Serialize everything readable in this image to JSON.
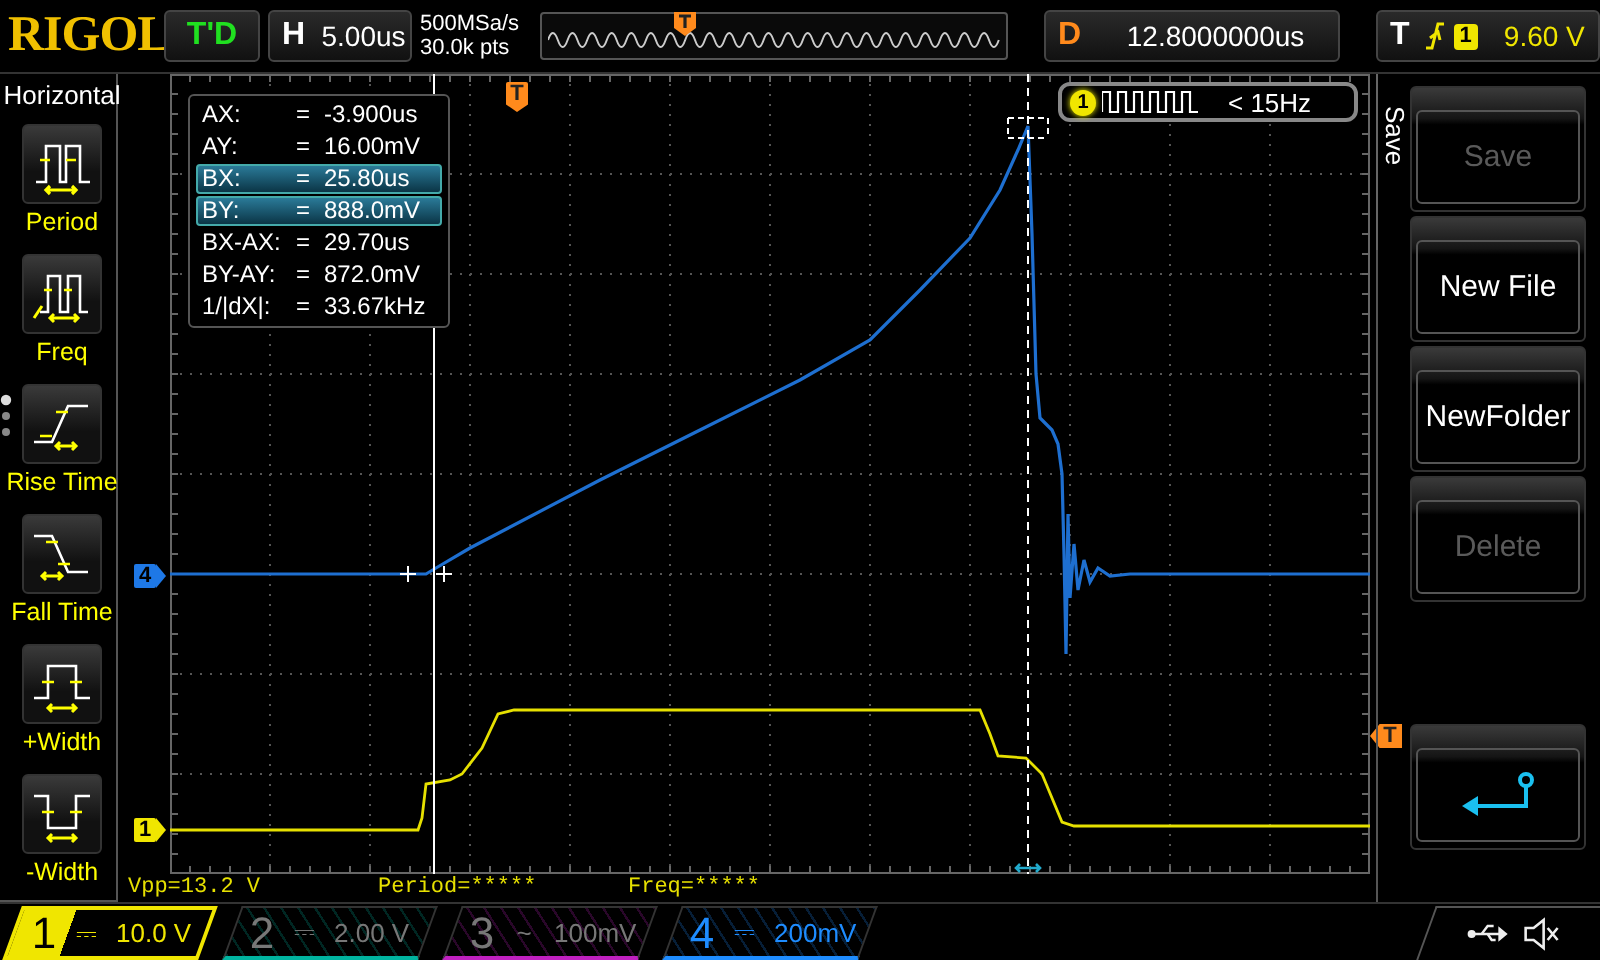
{
  "top_bar": {
    "logo": "RIGOL",
    "run_state": "T'D",
    "timebase": {
      "label": "H",
      "value": "5.00us"
    },
    "sample_rate": "500MSa/s",
    "memory_depth": "30.0k pts",
    "delay": {
      "label": "D",
      "value": "12.8000000us"
    },
    "trigger": {
      "label": "T",
      "source": "1",
      "level": "9.60 V"
    }
  },
  "left_menu": {
    "title": "Horizontal",
    "items": [
      {
        "kind": "period",
        "label": "Period"
      },
      {
        "kind": "freq",
        "label": "Freq"
      },
      {
        "kind": "rise",
        "label": "Rise Time"
      },
      {
        "kind": "fall",
        "label": "Fall Time"
      },
      {
        "kind": "pwidth",
        "label": "+Width"
      },
      {
        "kind": "nwidth",
        "label": "-Width"
      }
    ]
  },
  "plot": {
    "channel_markers": [
      {
        "label": "4",
        "color": "#1e78e6"
      },
      {
        "label": "1",
        "color": "#f0e600"
      }
    ],
    "trigger_markers": [
      {
        "label": "T"
      },
      {
        "label": "T"
      }
    ],
    "cursor_readout": [
      {
        "name": "AX:",
        "sign": "=",
        "value": "-3.900us",
        "selected": false
      },
      {
        "name": "AY:",
        "sign": "=",
        "value": "16.00mV",
        "selected": false
      },
      {
        "name": "BX:",
        "sign": "=",
        "value": "25.80us",
        "selected": true
      },
      {
        "name": "BY:",
        "sign": "=",
        "value": "888.0mV",
        "selected": true
      },
      {
        "name": "BX-AX:",
        "sign": "=",
        "value": "29.70us",
        "selected": false
      },
      {
        "name": "BY-AY:",
        "sign": "=",
        "value": "872.0mV",
        "selected": false
      },
      {
        "name": "1/|dX|:",
        "sign": "=",
        "value": "33.67kHz",
        "selected": false
      }
    ],
    "frequency_badge": {
      "source": "1",
      "text": "< 15Hz"
    }
  },
  "right_menu": {
    "title": "Save",
    "buttons": [
      {
        "kind": "text",
        "label": "Save",
        "disabled": true
      },
      {
        "kind": "text",
        "label": "New File",
        "disabled": false
      },
      {
        "kind": "text",
        "label": "NewFolder",
        "disabled": false
      },
      {
        "kind": "text",
        "label": "Delete",
        "disabled": true
      },
      {
        "kind": "back",
        "disabled": false
      }
    ]
  },
  "measurements": [
    "Vpp=13.2 V",
    "Period=*****",
    "Freq=*****"
  ],
  "channels": [
    {
      "number": "1",
      "coupling": "⎓",
      "scale": "10.0 V",
      "selected": true,
      "on": true,
      "color": "#f0e600"
    },
    {
      "number": "2",
      "coupling": "⎓",
      "scale": "2.00 V",
      "selected": false,
      "on": false,
      "color": "#00b4a0"
    },
    {
      "number": "3",
      "coupling": "~",
      "scale": "100mV",
      "selected": false,
      "on": false,
      "color": "#c020c0"
    },
    {
      "number": "4",
      "coupling": "⎓",
      "scale": "200mV",
      "selected": false,
      "on": true,
      "color": "#1e8cff"
    }
  ]
}
